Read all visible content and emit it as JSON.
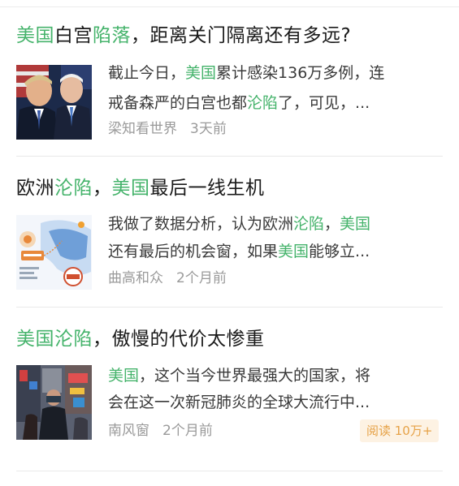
{
  "feed": {
    "articles": [
      {
        "title": {
          "p1": "美国",
          "p2": "白宫",
          "p3": "陷落",
          "p4": "，距离关门隔离还有多远?"
        },
        "snippet_line1": {
          "a": "截止今日，",
          "b": "美国",
          "c": "累计感染136万多例，连"
        },
        "snippet_line2": {
          "a": "戒备森严的白宫也都",
          "b": "沦陷",
          "c": "了，可见，..."
        },
        "source": "梁知看世界",
        "time": "3天前",
        "thumbnail_icon": "politicians-photo"
      },
      {
        "title": {
          "p1": "欧洲",
          "p2": "沦陷",
          "p3": "，",
          "p4": "美国",
          "p5": "最后一线生机"
        },
        "snippet_line1": {
          "a": "我做了数据分析，认为欧洲",
          "b": "沦陷",
          "c": "，",
          "d": "美国"
        },
        "snippet_line2": {
          "a": "还有最后的机会窗，如果",
          "b": "美国",
          "c": "能够立..."
        },
        "source": "曲高和众",
        "time": "2个月前",
        "thumbnail_icon": "data-map-infographic"
      },
      {
        "title": {
          "p1": "美国沦陷",
          "p2": "，傲慢的代价太惨重"
        },
        "snippet_line1": {
          "a": "美国",
          "b": "，这个当今世界最强大的国家，将"
        },
        "snippet_line2": {
          "a": "会在这一次新冠肺炎的全球大流行中..."
        },
        "source": "南风窗",
        "time": "2个月前",
        "read_badge": "阅读 10万+",
        "thumbnail_icon": "city-street-photo"
      }
    ]
  },
  "colors": {
    "highlight": "#45b36b",
    "badge_text": "#e6a247",
    "badge_bg": "#fdf2e3",
    "meta": "#9a9a9a"
  }
}
